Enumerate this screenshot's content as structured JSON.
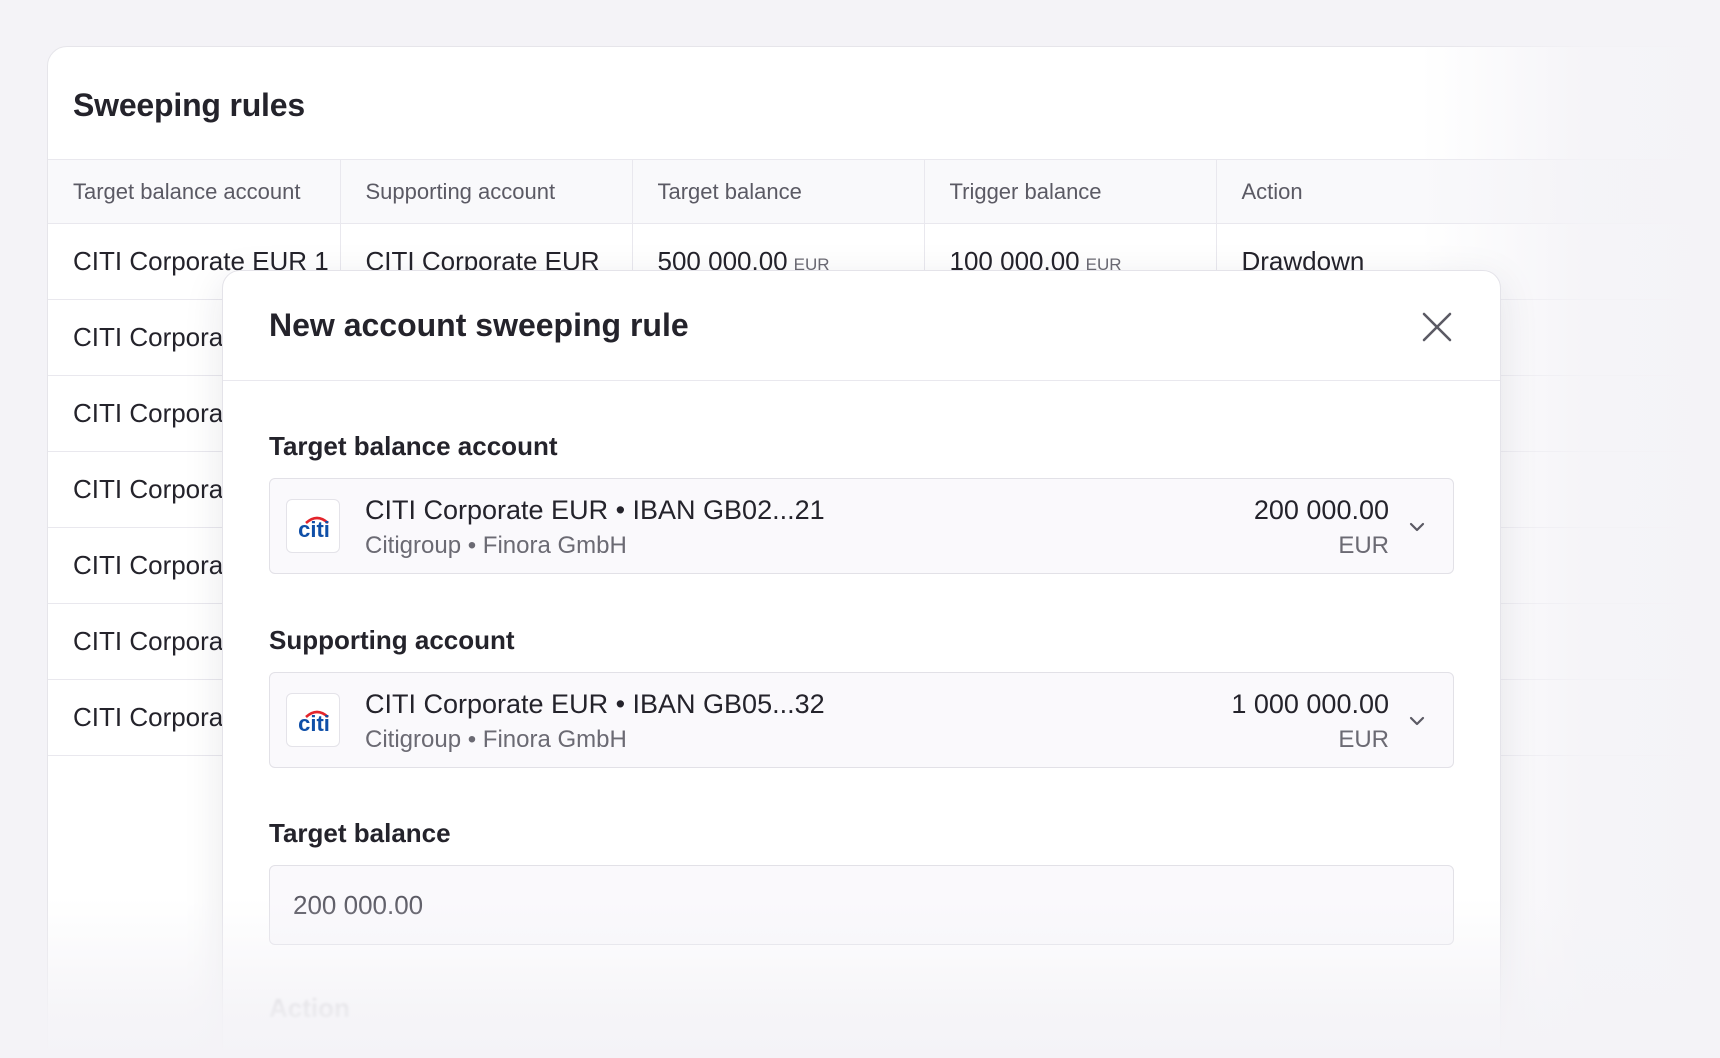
{
  "background_panel": {
    "title": "Sweeping rules",
    "columns": [
      "Target balance account",
      "Supporting account",
      "Target balance",
      "Trigger balance",
      "Action"
    ],
    "rows": [
      {
        "target_account": "CITI Corporate EUR 1",
        "supporting_account": "CITI Corporate EUR",
        "target_balance": "500 000.00",
        "target_currency": "EUR",
        "trigger_balance": "100 000.00",
        "trigger_currency": "EUR",
        "action": "Drawdown"
      },
      {
        "target_account": "CITI Corpora"
      },
      {
        "target_account": "CITI Corpora"
      },
      {
        "target_account": "CITI Corpora"
      },
      {
        "target_account": "CITI Corpora"
      },
      {
        "target_account": "CITI Corpora"
      },
      {
        "target_account": "CITI Corpora"
      }
    ]
  },
  "modal": {
    "title": "New account sweeping rule",
    "close_icon": "close-icon",
    "target_account": {
      "label": "Target balance account",
      "logo_text": "citi",
      "name": "CITI Corporate EUR • IBAN GB02...21",
      "sub": "Citigroup • Finora GmbH",
      "amount": "200 000.00",
      "currency": "EUR"
    },
    "supporting_account": {
      "label": "Supporting account",
      "logo_text": "citi",
      "name": "CITI Corporate EUR • IBAN GB05...32",
      "sub": "Citigroup • Finora GmbH",
      "amount": "1 000 000.00",
      "currency": "EUR"
    },
    "target_balance": {
      "label": "Target balance",
      "value": "200 000.00"
    },
    "action": {
      "label": "Action"
    }
  },
  "colors": {
    "page_bg": "#f4f3f7",
    "citi_blue": "#0f4fa8",
    "citi_red": "#e3242b",
    "text_primary": "#24232b",
    "text_secondary": "#6b6a73"
  }
}
